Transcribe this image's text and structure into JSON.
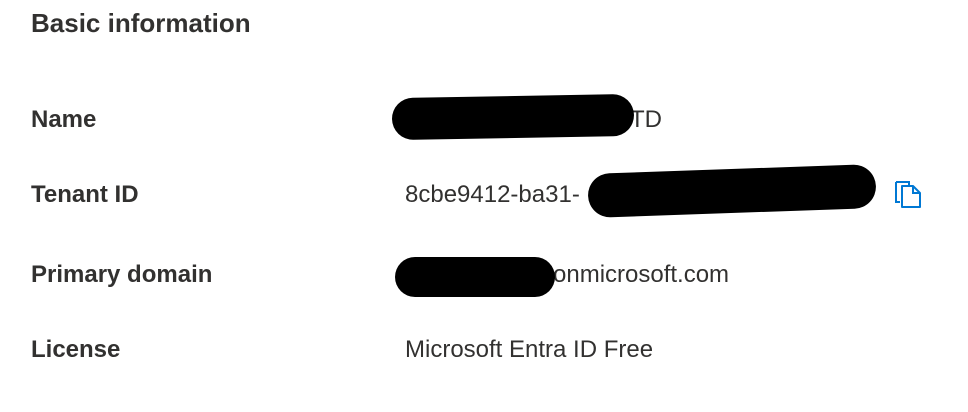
{
  "section": {
    "title": "Basic information"
  },
  "rows": [
    {
      "label": "Name",
      "value": "TD"
    },
    {
      "label": "Tenant ID",
      "value": "8cbe9412-ba31-"
    },
    {
      "label": "Primary domain",
      "value": "onmicrosoft.com"
    },
    {
      "label": "License",
      "value": "Microsoft Entra ID Free"
    }
  ],
  "icons": {
    "copy": "copy-icon"
  },
  "colors": {
    "text": "#323130",
    "accent": "#0078d4",
    "redaction": "#000000"
  }
}
